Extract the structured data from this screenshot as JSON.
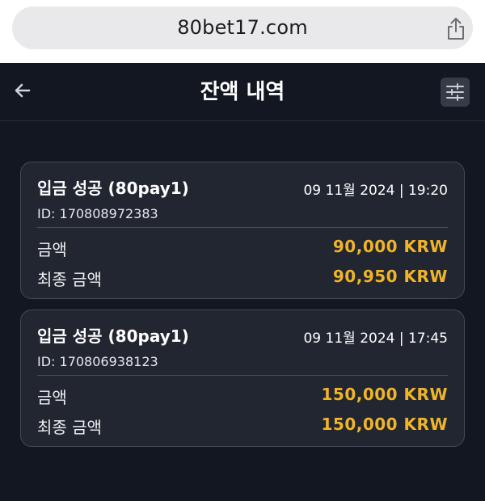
{
  "browser": {
    "url": "80bet17.com",
    "share_icon": "share-icon"
  },
  "header": {
    "title": "잔액 내역",
    "back_icon": "back-arrow-icon",
    "filter_icon": "sliders-icon"
  },
  "transactions": [
    {
      "title": "입금 성공 (80pay1)",
      "date": "09 11월 2024 | 19:20",
      "id": "ID: 170808972383",
      "amount_label": "금액",
      "amount": "90,000 KRW",
      "final_label": "최종 금액",
      "final_amount": "90,950 KRW"
    },
    {
      "title": "입금 성공 (80pay1)",
      "date": "09 11월 2024 | 17:45",
      "id": "ID: 170806938123",
      "amount_label": "금액",
      "amount": "150,000 KRW",
      "final_label": "최종 금액",
      "final_amount": "150,000 KRW"
    }
  ],
  "colors": {
    "background": "#121722",
    "card": "#212631",
    "accent_amount": "#f0b429"
  }
}
